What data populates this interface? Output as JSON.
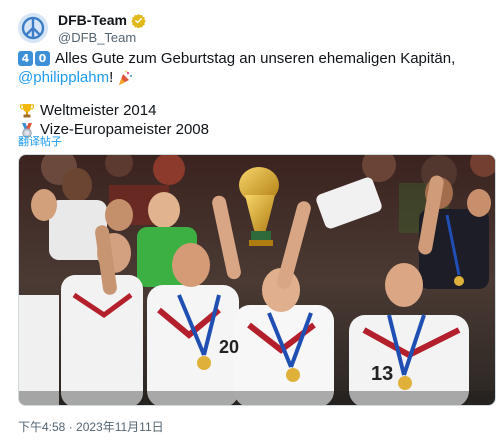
{
  "author": {
    "display_name": "DFB-Team",
    "handle": "@DFB_Team",
    "verified": true,
    "avatar_icon": "peace-symbol-icon"
  },
  "tweet": {
    "number_keycaps": [
      "4",
      "0"
    ],
    "line1_text": "Alles Gute zum Geburtstag an unseren ehemaligen Kapitän,",
    "mention": "@philipplahm",
    "mention_suffix": "!",
    "line1_end_icon": "party-popper-icon",
    "achievements": [
      {
        "icon": "trophy-icon",
        "text": "Weltmeister 2014"
      },
      {
        "icon": "medal-icon",
        "text": "Vize-Europameister 2008"
      }
    ],
    "translate_label": "翻译帖子"
  },
  "media": {
    "description_icon": "team-celebration-photo"
  },
  "timestamp": "下午4:58 · 2023年11月11日",
  "colors": {
    "link": "#1d9bf0",
    "secondary_text": "#536471",
    "keycap": "#3d8fd8",
    "verified": "#e2b719"
  }
}
